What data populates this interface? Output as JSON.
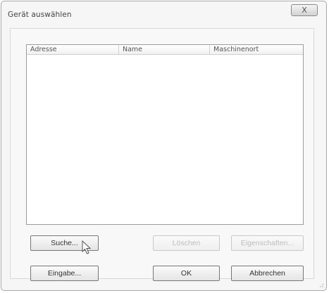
{
  "window": {
    "title": "Gerät auswählen",
    "close_label": "X"
  },
  "list": {
    "columns": [
      "Adresse",
      "Name",
      "Maschinenort"
    ],
    "rows": []
  },
  "buttons": {
    "search": "Suche...",
    "delete": "Löschen",
    "properties": "Eigenschaften...",
    "input": "Eingabe...",
    "ok": "OK",
    "cancel": "Abbrechen"
  },
  "colors": {
    "disabled_text": "#bdbdbd",
    "border": "#9c9c9c"
  }
}
